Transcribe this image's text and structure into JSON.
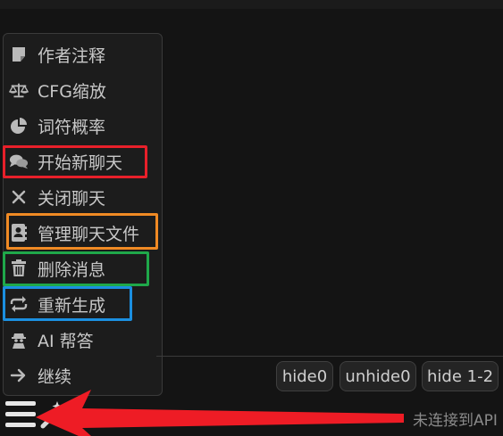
{
  "menu": {
    "items": [
      {
        "label": "作者注释",
        "icon": "note-icon"
      },
      {
        "label": "CFG缩放",
        "icon": "scale-icon"
      },
      {
        "label": "词符概率",
        "icon": "pie-chart-icon"
      },
      {
        "label": "开始新聊天",
        "icon": "comments-icon"
      },
      {
        "label": "关闭聊天",
        "icon": "close-icon"
      },
      {
        "label": "管理聊天文件",
        "icon": "address-book-icon"
      },
      {
        "label": "删除消息",
        "icon": "trash-icon"
      },
      {
        "label": "重新生成",
        "icon": "repeat-icon"
      },
      {
        "label": "AI 帮答",
        "icon": "user-secret-icon"
      },
      {
        "label": "继续",
        "icon": "arrow-right-icon"
      }
    ]
  },
  "quick_replies": [
    "hide0",
    "unhide0",
    "hide 1-2"
  ],
  "status": {
    "text": "未连接到API"
  },
  "highlight_colors": {
    "red": "#e8202a",
    "orange": "#f08a24",
    "green": "#1fa84a",
    "blue": "#1b8fe0"
  },
  "arrow_color": "#ee1c25"
}
